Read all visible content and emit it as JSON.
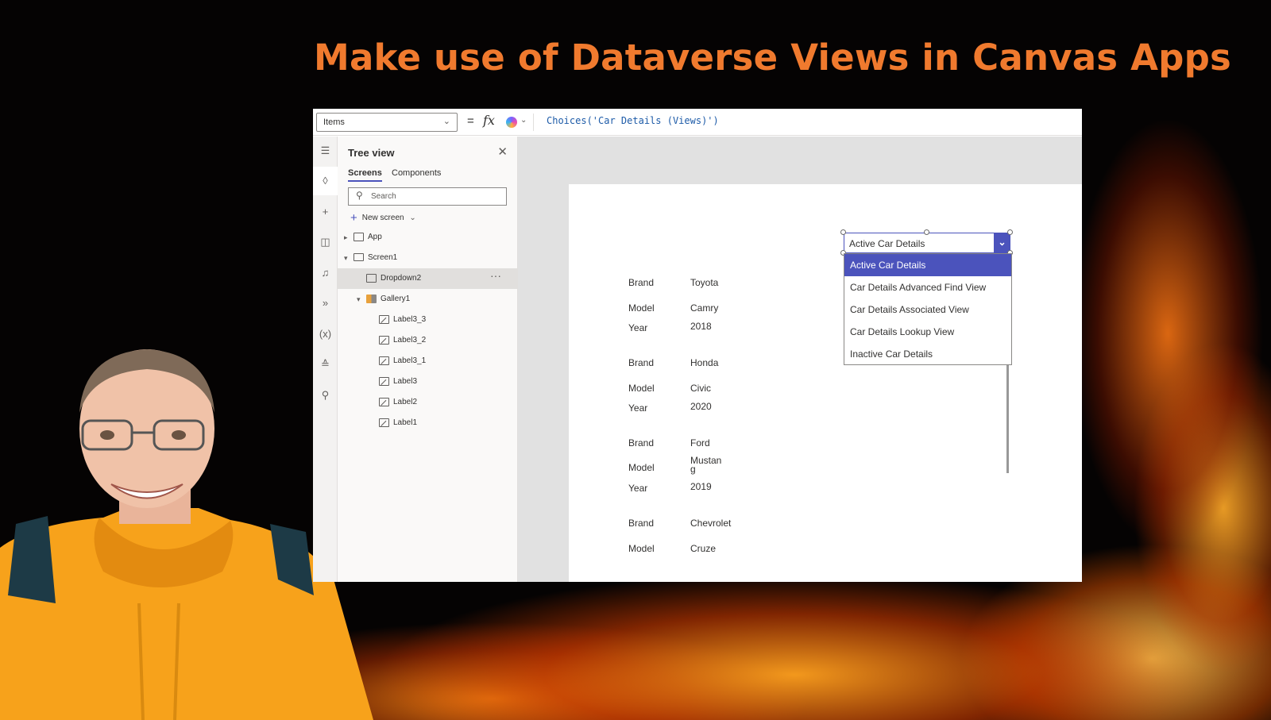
{
  "headline": "Make use of Dataverse Views in Canvas Apps",
  "formula_bar": {
    "property": "Items",
    "equals": "=",
    "fx": "fx",
    "formula": "Choices('Car Details (Views)')"
  },
  "tree_view": {
    "title": "Tree view",
    "tabs": [
      "Screens",
      "Components"
    ],
    "search_placeholder": "Search",
    "new_screen": "New screen",
    "nodes": {
      "app": "App",
      "screen1": "Screen1",
      "dropdown2": "Dropdown2",
      "gallery1": "Gallery1",
      "label3_3": "Label3_3",
      "label3_2": "Label3_2",
      "label3_1": "Label3_1",
      "label3": "Label3",
      "label2": "Label2",
      "label1": "Label1"
    }
  },
  "gallery": {
    "fields": {
      "brand": "Brand",
      "model": "Model",
      "year": "Year"
    },
    "items": [
      {
        "brand": "Toyota",
        "model": "Camry",
        "year": "2018"
      },
      {
        "brand": "Honda",
        "model": "Civic",
        "year": "2020"
      },
      {
        "brand": "Ford",
        "model": "Mustan\ng",
        "year": "2019"
      },
      {
        "brand": "Chevrolet",
        "model": "Cruze"
      }
    ]
  },
  "dropdown": {
    "selected": "Active Car Details",
    "options": [
      "Active Car Details",
      "Car Details Advanced Find View",
      "Car Details Associated View",
      "Car Details Lookup View",
      "Inactive Car Details"
    ]
  },
  "colors": {
    "headline": "#f07a2e",
    "accent": "#4b53bc"
  }
}
